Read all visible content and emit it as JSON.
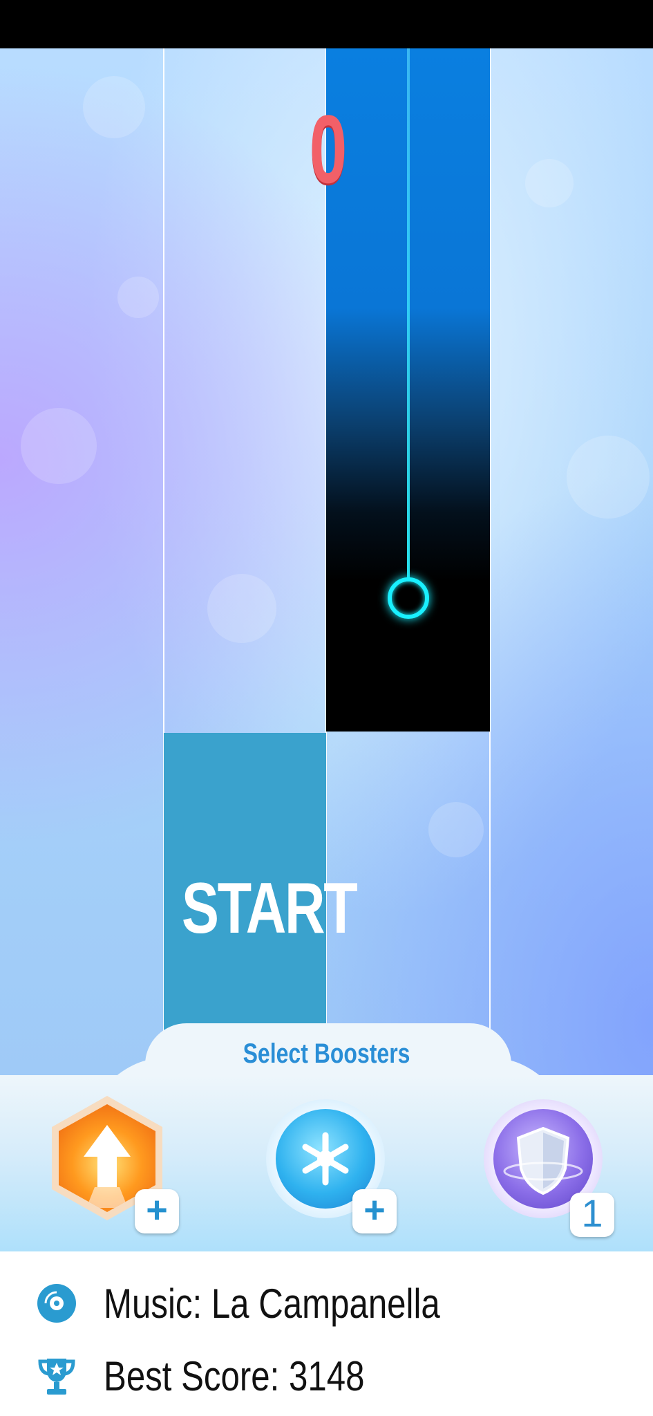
{
  "game": {
    "score": "0",
    "start_label": "START",
    "colors": {
      "score": "#f26068",
      "start_tile": "#3aa2cd",
      "ring": "#19f0ff",
      "accent": "#2a8ed6"
    }
  },
  "boosters": {
    "title": "Select Boosters",
    "items": [
      {
        "icon": "up-arrow-hexagon-icon",
        "badge": "+"
      },
      {
        "icon": "snowflake-icon",
        "badge": "+"
      },
      {
        "icon": "shield-icon",
        "badge": "1"
      }
    ]
  },
  "info": {
    "music": "Music: La Campanella",
    "best_score": "Best Score: 3148"
  }
}
